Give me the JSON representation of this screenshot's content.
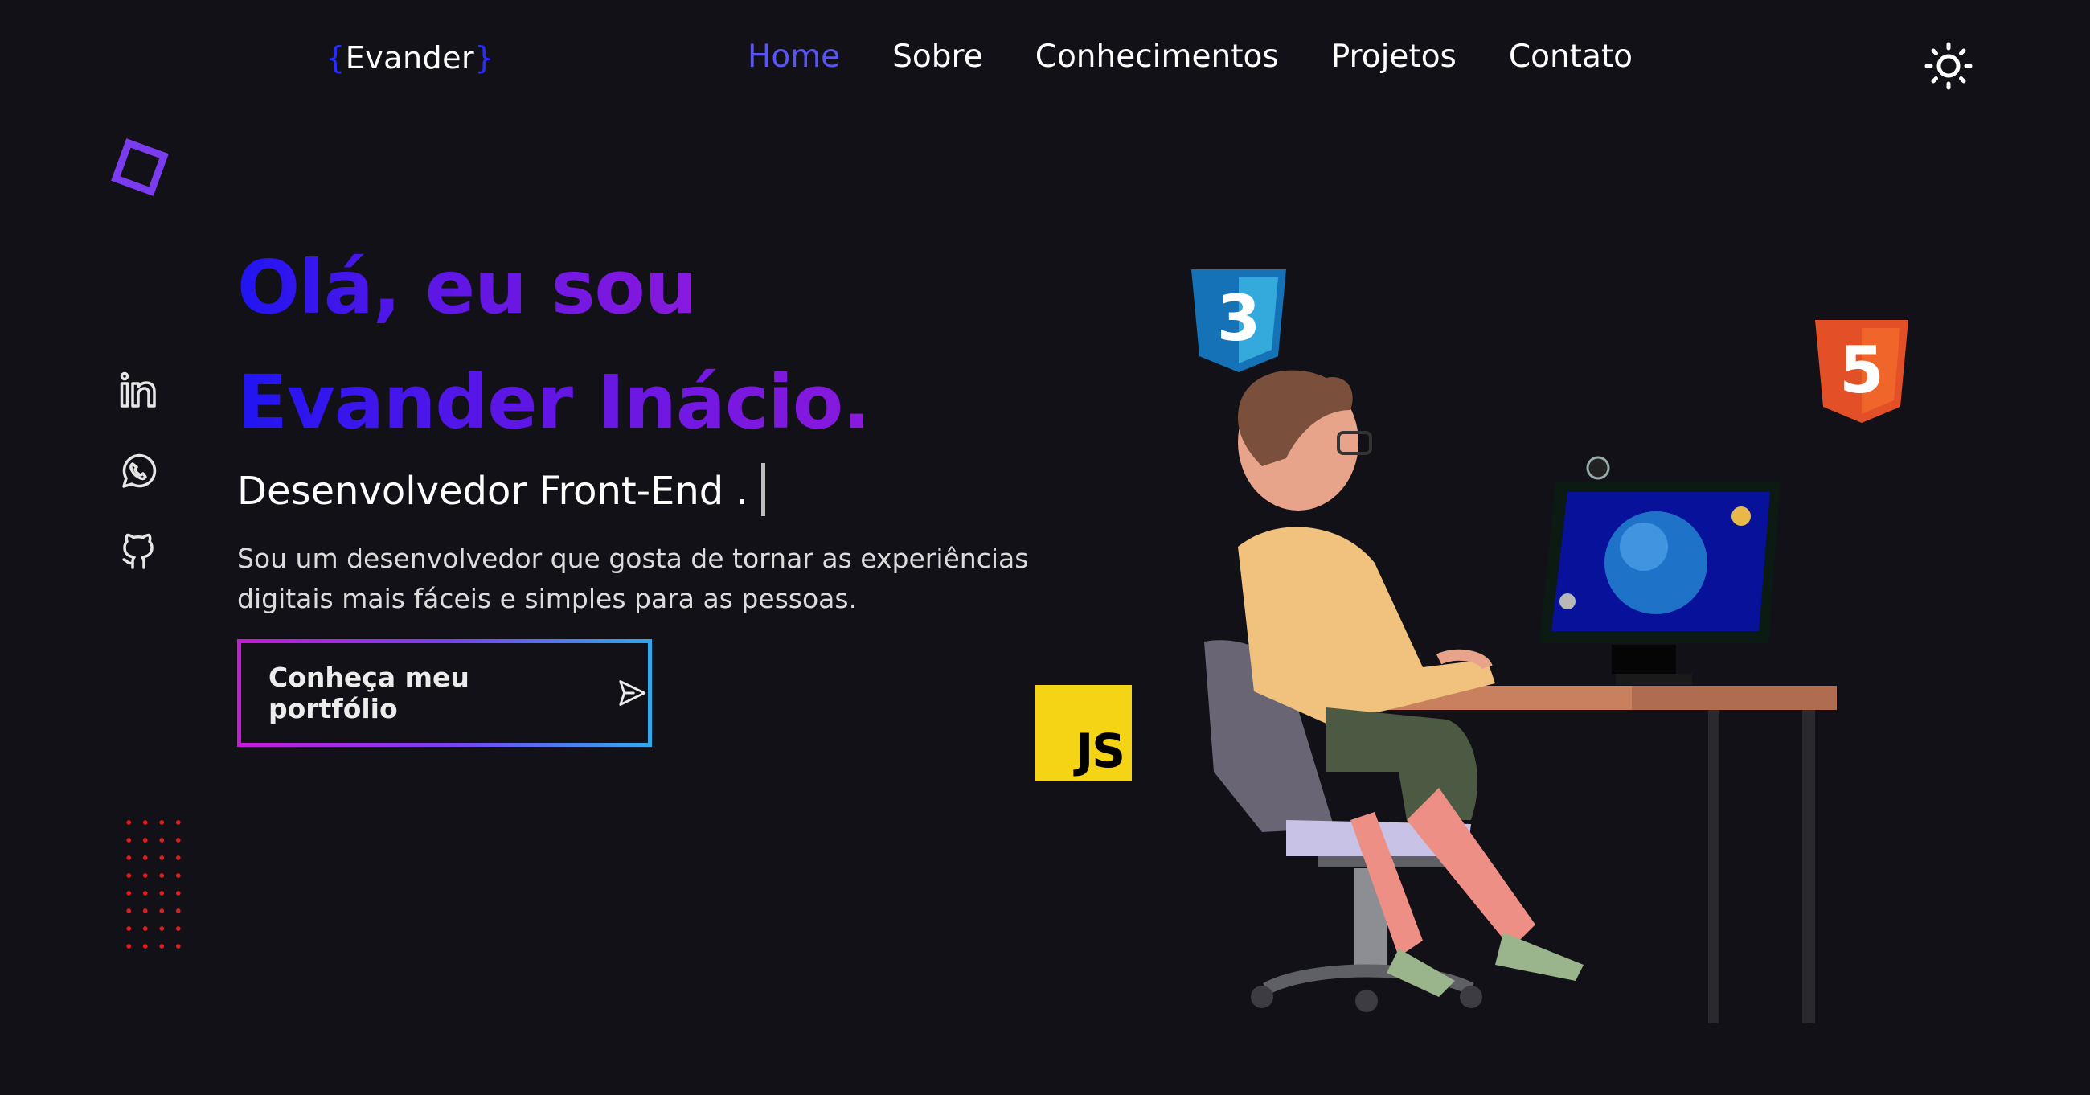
{
  "header": {
    "logo": {
      "brace_open": "{",
      "name": "Evander",
      "brace_close": "}"
    },
    "nav": [
      {
        "label": "Home",
        "active": true
      },
      {
        "label": "Sobre",
        "active": false
      },
      {
        "label": "Conhecimentos",
        "active": false
      },
      {
        "label": "Projetos",
        "active": false
      },
      {
        "label": "Contato",
        "active": false
      }
    ],
    "theme_toggle_icon": "sun-icon"
  },
  "social": [
    {
      "name": "linkedin-icon"
    },
    {
      "name": "whatsapp-icon"
    },
    {
      "name": "github-icon"
    }
  ],
  "hero": {
    "greeting": "Olá, eu sou",
    "name": "Evander Inácio.",
    "role": "Desenvolvedor Front-End .",
    "description": "Sou um desenvolvedor que gosta de tornar as experiências digitais mais fáceis e simples para as pessoas.",
    "cta_label": "Conheça meu portfólio",
    "cta_icon": "send-icon"
  },
  "badges": {
    "css": "3",
    "html": "5",
    "js": "JS"
  },
  "colors": {
    "background": "#121117",
    "accent_blue": "#1f15f2",
    "accent_purple": "#8a19dd",
    "nav_active": "#5a54f0",
    "dots_red": "#e21b1b",
    "js_yellow": "#f5d415"
  }
}
